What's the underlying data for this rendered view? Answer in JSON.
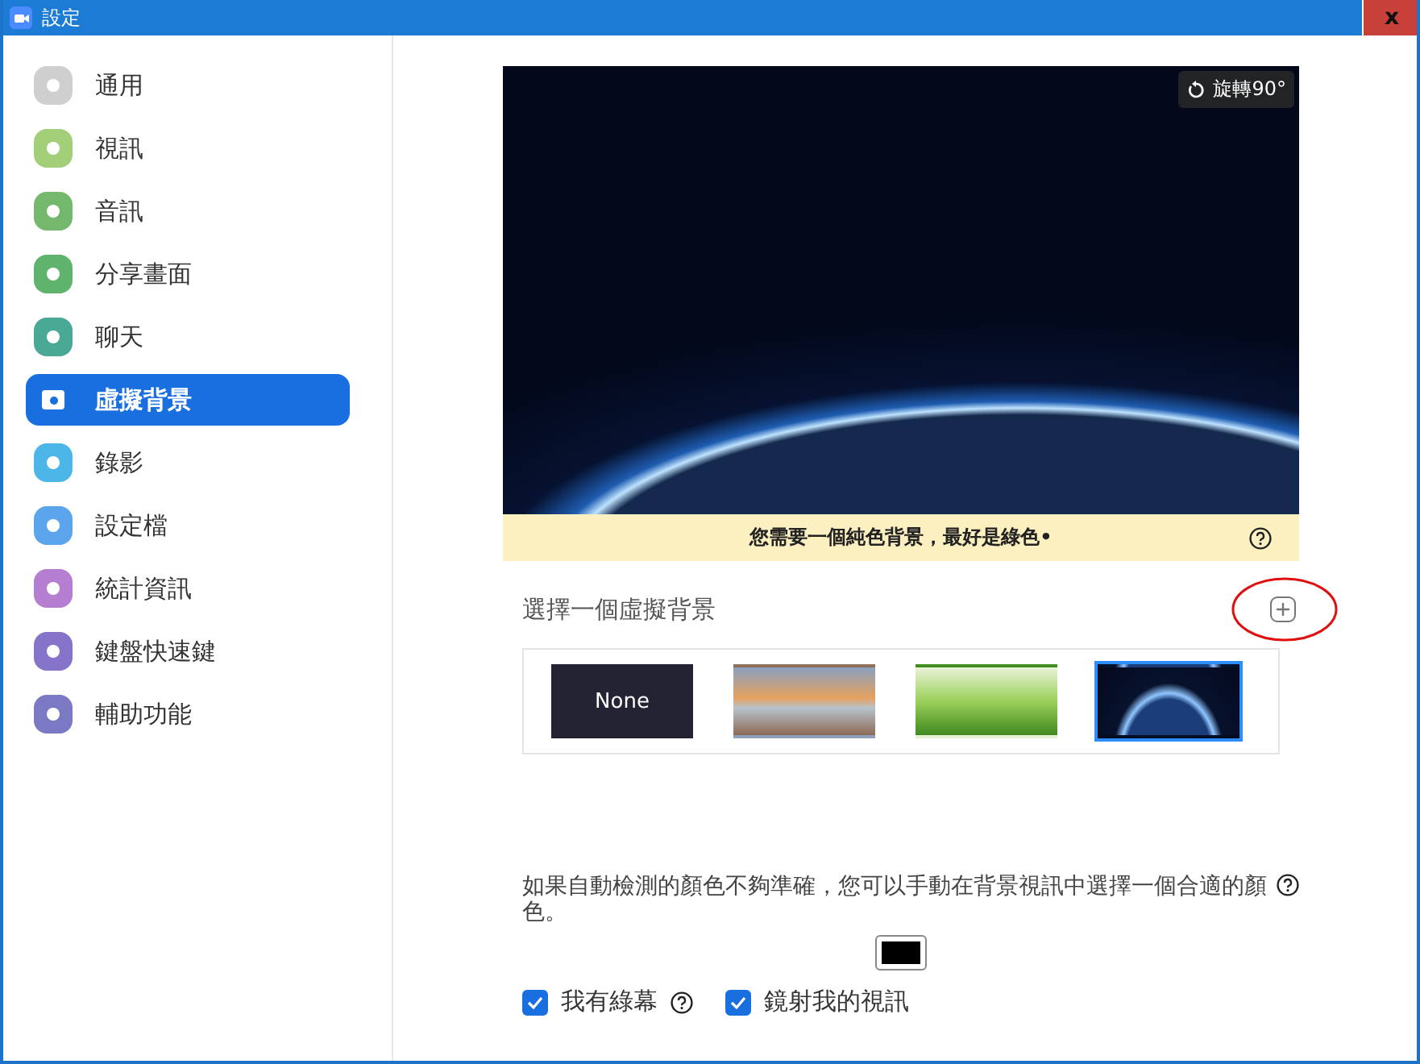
{
  "window": {
    "title": "設定",
    "close_label": "x"
  },
  "sidebar": {
    "items": [
      {
        "label": "通用",
        "selected": false
      },
      {
        "label": "視訊",
        "selected": false
      },
      {
        "label": "音訊",
        "selected": false
      },
      {
        "label": "分享畫面",
        "selected": false
      },
      {
        "label": "聊天",
        "selected": false
      },
      {
        "label": "虛擬背景",
        "selected": true
      },
      {
        "label": "錄影",
        "selected": false
      },
      {
        "label": "設定檔",
        "selected": false
      },
      {
        "label": "統計資訊",
        "selected": false
      },
      {
        "label": "鍵盤快速鍵",
        "selected": false
      },
      {
        "label": "輔助功能",
        "selected": false
      }
    ]
  },
  "preview": {
    "rotate_label": "旋轉90°",
    "notice": "您需要一個純色背景，最好是綠色•"
  },
  "backgrounds": {
    "heading": "選擇一個虛擬背景",
    "annotation_circle": true,
    "items": [
      {
        "kind": "none",
        "label": "None",
        "selected": false
      },
      {
        "kind": "bridge",
        "selected": false
      },
      {
        "kind": "grass",
        "selected": false
      },
      {
        "kind": "earth",
        "selected": true
      }
    ]
  },
  "color_hint": "如果自動檢測的顏色不夠準確，您可以手動在背景視訊中選擇一個合適的顏色。",
  "color_picker": {
    "color": "#000000"
  },
  "options": [
    {
      "label": "我有綠幕",
      "checked": true,
      "help": true
    },
    {
      "label": "鏡射我的視訊",
      "checked": true,
      "help": false
    }
  ]
}
